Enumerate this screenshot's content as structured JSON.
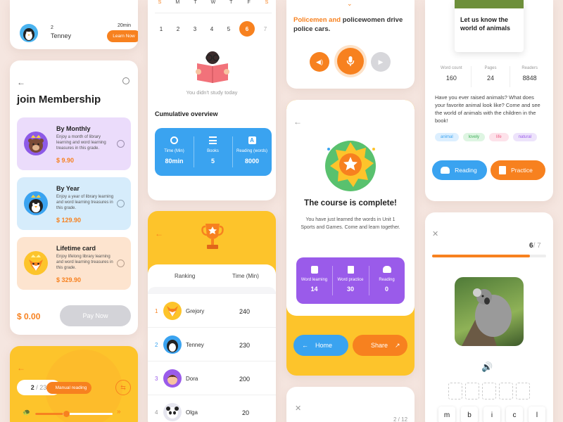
{
  "c1": {
    "count": "2",
    "name": "Tenney",
    "minutes": "20min",
    "learn_label": "Learn Now"
  },
  "membership": {
    "title": "join Membership",
    "plans": [
      {
        "name": "By Monthly",
        "desc": "Enjoy a month of library learning and word learning treasures in this grade.",
        "price": "$ 9.90"
      },
      {
        "name": "By Year",
        "desc": "Enjoy a year of library learning and word learning treasures in this grade.",
        "price": "$ 129.90"
      },
      {
        "name": "Lifetime card",
        "desc": "Enjoy lifelong library learning and word learning treasures in this grade.",
        "price": "$ 329.90"
      }
    ],
    "total": "$ 0.00",
    "pay_label": "Pay Now"
  },
  "reading": {
    "page": "2",
    "total": "/ 23",
    "mode_label": "Manual reading"
  },
  "calendar": {
    "weekdays": [
      "S",
      "M",
      "T",
      "W",
      "T",
      "F",
      "S"
    ],
    "days": [
      "1",
      "2",
      "3",
      "4",
      "5",
      "6",
      "7"
    ],
    "empty_text": "You didn't study today",
    "overview_title": "Cumulative overview",
    "stats": [
      {
        "label": "Time (Min)",
        "value": "80min"
      },
      {
        "label": "Books",
        "value": "5"
      },
      {
        "label": "Reading (words)",
        "value": "8000"
      }
    ]
  },
  "ranking": {
    "col_rank": "Ranking",
    "col_time": "Time (Min)",
    "rows": [
      {
        "rank": "1",
        "name": "Grejory",
        "time": "240"
      },
      {
        "rank": "2",
        "name": "Tenney",
        "time": "230"
      },
      {
        "rank": "3",
        "name": "Dora",
        "time": "200"
      },
      {
        "rank": "4",
        "name": "Olga",
        "time": "20"
      }
    ]
  },
  "sentence": {
    "highlight": "Policemen and",
    "rest": " policewomen drive police cars."
  },
  "complete": {
    "title": "The course is complete!",
    "desc": "You have just learned the words in Unit 1 Sports and Games. Come and learn together.",
    "stats": [
      {
        "label": "Word learning",
        "value": "14"
      },
      {
        "label": "Word practice",
        "value": "30"
      },
      {
        "label": "Reading",
        "value": "0"
      }
    ],
    "home_label": "Home",
    "share_label": "Share"
  },
  "bottom_mid": {
    "progress": "2 / 12"
  },
  "book": {
    "cover_title": "Let us know the world of animals",
    "meta": [
      {
        "label": "Word count",
        "value": "160"
      },
      {
        "label": "Pages",
        "value": "24"
      },
      {
        "label": "Readers",
        "value": "8848"
      }
    ],
    "desc": "Have you ever raised animals? What does your favorite animal look like? Come and see the world of animals with the children in the book!",
    "tags": [
      "animal",
      "lovely",
      "life",
      "natural"
    ],
    "reading_label": "Reading",
    "practice_label": "Practice"
  },
  "quiz": {
    "current": "6",
    "total": "/ 7",
    "progress": 0.857,
    "letters": [
      "m",
      "b",
      "i",
      "c",
      "l"
    ]
  },
  "colors": {
    "orange": "#f7811f",
    "blue": "#3aa3f0",
    "purple": "#9a5bea",
    "yellow": "#fdc42b"
  }
}
